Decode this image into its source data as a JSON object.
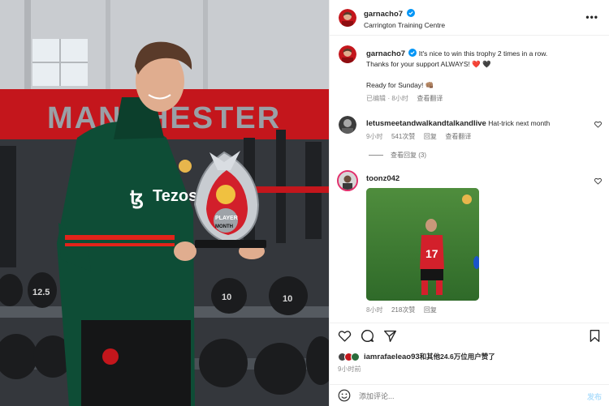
{
  "post": {
    "author": "garnacho7",
    "location": "Carrington Training Centre",
    "caption_line1": "It's nice to win this trophy 2 times in a row.",
    "caption_line2": "Thanks for your support ALWAYS!",
    "caption_emoji": "❤️ 🖤",
    "caption_line3": "Ready for Sunday! 👊🏽",
    "edited": "已编辑",
    "time": "8小时",
    "see_translation": "查看翻译"
  },
  "photo": {
    "wall_text": "MANCHESTER",
    "sponsor_text": "Tezos",
    "trophy_text_1": "PLAYER",
    "trophy_text_2": "MONTH",
    "dumbbell_1": "12.5",
    "dumbbell_2": "10",
    "dumbbell_3": "10"
  },
  "comments": [
    {
      "user": "letusmeetandwalkandtalkandlive",
      "text": "Hat-trick next month",
      "time": "9小时",
      "likes": "541次赞",
      "reply": "回复",
      "translate": "查看翻译",
      "view_replies": "查看回复 (3)"
    },
    {
      "user": "toonz042",
      "time": "8小时",
      "likes": "218次赞",
      "reply": "回复",
      "jersey_number": "17"
    }
  ],
  "likes_bar": {
    "text_user": "iamrafaeleao93",
    "text_rest": "和其他24.6万位用户赞了",
    "time": "9小时前"
  },
  "add_comment": {
    "placeholder": "添加评论...",
    "post_label": "发布"
  },
  "icons": {
    "more": "more-horizontal-icon",
    "like": "heart-icon",
    "comment": "comment-icon",
    "share": "share-icon",
    "save": "bookmark-icon",
    "emoji": "emoji-icon"
  },
  "colors": {
    "link_blue": "#0095f6",
    "verified_blue": "#0095f6",
    "text": "#262626",
    "muted": "#8e8e8e"
  }
}
